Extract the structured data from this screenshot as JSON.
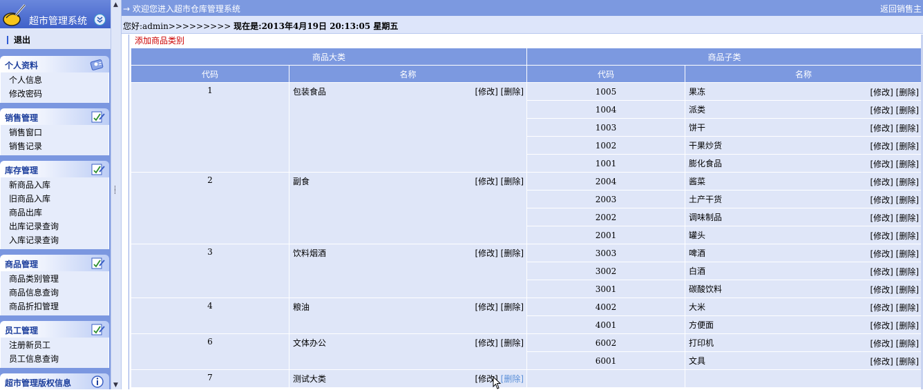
{
  "sidebar": {
    "title": "超市管理系统",
    "logout": "退出",
    "panels": [
      {
        "title": "个人资料",
        "icon": "user-info-icon",
        "items": [
          "个人信息",
          "修改密码"
        ]
      },
      {
        "title": "销售管理",
        "icon": "edit-note-icon",
        "items": [
          "销售窗口",
          "销售记录"
        ]
      },
      {
        "title": "库存管理",
        "icon": "edit-note-icon",
        "items": [
          "新商品入库",
          "旧商品入库",
          "商品出库",
          "出库记录查询",
          "入库记录查询"
        ]
      },
      {
        "title": "商品管理",
        "icon": "edit-note-icon",
        "items": [
          "商品类别管理",
          "商品信息查询",
          "商品折扣管理"
        ]
      },
      {
        "title": "员工管理",
        "icon": "edit-note-icon",
        "items": [
          "注册新员工",
          "员工信息查询"
        ]
      },
      {
        "title": "超市管理版权信息",
        "icon": "info-icon",
        "items": []
      }
    ]
  },
  "topbar": {
    "welcome": "→ 欢迎您进入超市仓库管理系统",
    "back_link": "返回销售主"
  },
  "greeting": {
    "prefix": "您好:admin>>>>>>>>> ",
    "now_label": "现在是:",
    "datetime": "2013年4月19日  20:13:05 星期五"
  },
  "content": {
    "add_category": "添加商品类别",
    "headers": {
      "major": "商品大类",
      "minor": "商品子类",
      "code": "代码",
      "name": "名称"
    },
    "edit_label": "[修改]",
    "delete_label": "[删除]",
    "categories": [
      {
        "code": "1",
        "name": "包装食品",
        "subs": [
          {
            "code": "1005",
            "name": "果冻"
          },
          {
            "code": "1004",
            "name": "派类"
          },
          {
            "code": "1003",
            "name": "饼干"
          },
          {
            "code": "1002",
            "name": "干果炒货"
          },
          {
            "code": "1001",
            "name": "膨化食品"
          }
        ]
      },
      {
        "code": "2",
        "name": "副食",
        "subs": [
          {
            "code": "2004",
            "name": "酱菜"
          },
          {
            "code": "2003",
            "name": "土产干货"
          },
          {
            "code": "2002",
            "name": "调味制品"
          },
          {
            "code": "2001",
            "name": "罐头"
          }
        ]
      },
      {
        "code": "3",
        "name": "饮料烟酒",
        "subs": [
          {
            "code": "3003",
            "name": "啤酒"
          },
          {
            "code": "3002",
            "name": "白酒"
          },
          {
            "code": "3001",
            "name": "碳酸饮料"
          }
        ]
      },
      {
        "code": "4",
        "name": "粮油",
        "subs": [
          {
            "code": "4002",
            "name": "大米"
          },
          {
            "code": "4001",
            "name": "方便面"
          }
        ]
      },
      {
        "code": "6",
        "name": "文体办公",
        "subs": [
          {
            "code": "6002",
            "name": "打印机"
          },
          {
            "code": "6001",
            "name": "文具"
          }
        ]
      },
      {
        "code": "7",
        "name": "测试大类",
        "subs": []
      }
    ]
  }
}
